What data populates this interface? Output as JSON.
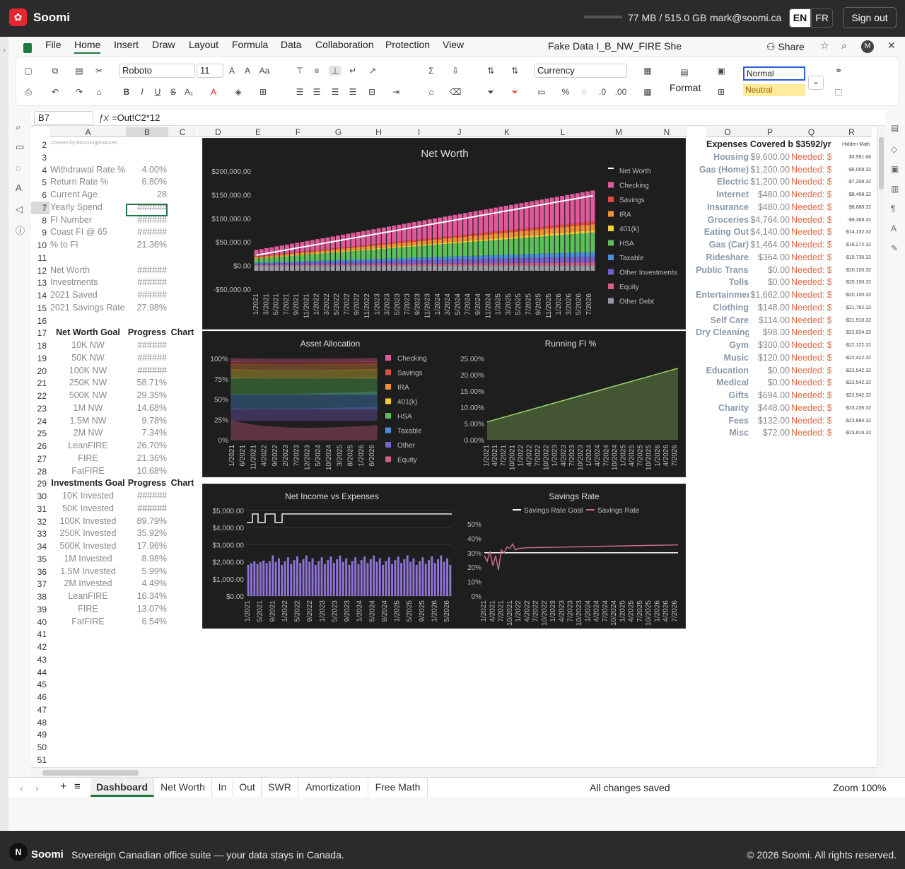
{
  "app": {
    "brand": "Soomi",
    "storage": "77 MB / 515.0 GB",
    "email": "mark@soomi.ca",
    "lang_en": "EN",
    "lang_fr": "FR",
    "signout": "Sign out"
  },
  "menu": [
    "File",
    "Home",
    "Insert",
    "Draw",
    "Layout",
    "Formula",
    "Data",
    "Collaboration",
    "Protection",
    "View"
  ],
  "doc": {
    "title": "Fake Data I_B_NW_FIRE She",
    "share": "Share"
  },
  "ribbon": {
    "font": "Roboto",
    "size": "11",
    "number_format": "Currency",
    "format_label": "Format",
    "style_normal": "Normal",
    "style_neutral": "Neutral"
  },
  "formula_bar": {
    "cell": "B7",
    "formula": "=Out!C2*12"
  },
  "columns": [
    "A",
    "B",
    "C",
    "D",
    "E",
    "F",
    "G",
    "H",
    "I",
    "J",
    "K",
    "L",
    "M",
    "N",
    "O",
    "P",
    "Q",
    "R"
  ],
  "rows_top": [
    "2",
    "3",
    "4",
    "5",
    "6",
    "7",
    "8",
    "9",
    "10",
    "11",
    "12",
    "13",
    "14",
    "15",
    "16",
    "17",
    "18",
    "19",
    "20",
    "21",
    "22",
    "23",
    "24",
    "25",
    "26",
    "27",
    "28",
    "29",
    "30",
    "31",
    "32",
    "33",
    "34",
    "35",
    "36",
    "37",
    "38",
    "39",
    "40",
    "41",
    "42",
    "43",
    "44",
    "45",
    "46",
    "47",
    "48",
    "49",
    "50",
    "51"
  ],
  "left_table": {
    "partial_row_text": "Created by BloomingFinances",
    "stats": [
      {
        "row": 4,
        "label": "Withdrawal Rate %",
        "value": "4.00%"
      },
      {
        "row": 5,
        "label": "Return Rate %",
        "value": "6.80%"
      },
      {
        "row": 6,
        "label": "Current Age",
        "value": "28"
      },
      {
        "row": 7,
        "label": "Yearly Spend",
        "value": "######"
      },
      {
        "row": 8,
        "label": "FI Number",
        "value": "######"
      },
      {
        "row": 9,
        "label": "Coast FI @ 65",
        "value": "######"
      },
      {
        "row": 10,
        "label": "% to FI",
        "value": "21.36%"
      },
      {
        "row": 12,
        "label": "Net Worth",
        "value": "######"
      },
      {
        "row": 13,
        "label": "Investments",
        "value": "######"
      },
      {
        "row": 14,
        "label": "2021 Saved",
        "value": "######"
      },
      {
        "row": 15,
        "label": "2021 Savings Rate",
        "value": "27.98%"
      }
    ],
    "nw_header": [
      "Net Worth Goal",
      "Progress",
      "Chart"
    ],
    "nw_goals": [
      [
        "10K NW",
        "######"
      ],
      [
        "50K NW",
        "######"
      ],
      [
        "100K NW",
        "######"
      ],
      [
        "250K NW",
        "58.71%"
      ],
      [
        "500K NW",
        "29.35%"
      ],
      [
        "1M NW",
        "14.68%"
      ],
      [
        "1.5M NW",
        "9.78%"
      ],
      [
        "2M NW",
        "7.34%"
      ],
      [
        "LeanFIRE",
        "26.70%"
      ],
      [
        "FIRE",
        "21.36%"
      ],
      [
        "FatFIRE",
        "10.68%"
      ]
    ],
    "inv_header": [
      "Investments Goal",
      "Progress",
      "Chart"
    ],
    "inv_goals": [
      [
        "10K Invested",
        "######"
      ],
      [
        "50K Invested",
        "######"
      ],
      [
        "100K Invested",
        "89.79%"
      ],
      [
        "250K Invested",
        "35.92%"
      ],
      [
        "500K Invested",
        "17.96%"
      ],
      [
        "1M Invested",
        "8.98%"
      ],
      [
        "1.5M Invested",
        "5.99%"
      ],
      [
        "2M Invested",
        "4.49%"
      ],
      [
        "LeanFIRE",
        "16.34%"
      ],
      [
        "FIRE",
        "13.07%"
      ],
      [
        "FatFIRE",
        "6.54%"
      ]
    ]
  },
  "expenses": {
    "title": "Expenses Covered b $3592/yr",
    "hidden_label": "Hidden Math",
    "items": [
      [
        "Housing",
        "$9,600.00",
        "Needed: $",
        "$3,591.68"
      ],
      [
        "Gas (Home)",
        "$1,200.00",
        "Needed: $",
        "-$6,008.32"
      ],
      [
        "Electric",
        "$1,200.00",
        "Needed: $",
        "-$7,208.32"
      ],
      [
        "Internet",
        "$480.00",
        "Needed: $",
        "-$8,408.32"
      ],
      [
        "Insurance",
        "$480.00",
        "Needed: $",
        "-$8,888.32"
      ],
      [
        "Groceries",
        "$4,764.00",
        "Needed: $",
        "-$9,368.32"
      ],
      [
        "Eating Out",
        "$4,140.00",
        "Needed: $",
        "-$14,132.32"
      ],
      [
        "Gas (Car)",
        "$1,464.00",
        "Needed: $",
        "-$18,272.32"
      ],
      [
        "Rideshare",
        "$364.00",
        "Needed: $",
        "-$19,736.32"
      ],
      [
        "Public Transi",
        "$0.00",
        "Needed: $",
        "-$20,100.32"
      ],
      [
        "Tolls",
        "$0.00",
        "Needed: $",
        "-$20,100.32"
      ],
      [
        "Entertainmer",
        "$1,662.00",
        "Needed: $",
        "-$20,100.32"
      ],
      [
        "Clothing",
        "$148.00",
        "Needed: $5",
        "-$21,762.32"
      ],
      [
        "Self Care",
        "$114.00",
        "Needed: $",
        "-$21,910.32"
      ],
      [
        "Dry Cleaning",
        "$98.00",
        "Needed: $",
        "-$22,024.32"
      ],
      [
        "Gym",
        "$300.00",
        "Needed: $",
        "-$22,122.32"
      ],
      [
        "Music",
        "$120.00",
        "Needed: $",
        "-$22,422.32"
      ],
      [
        "Education",
        "$0.00",
        "Needed: $",
        "-$22,542.32"
      ],
      [
        "Medical",
        "$0.00",
        "Needed: $",
        "-$22,542.32"
      ],
      [
        "Gifts",
        "$694.00",
        "Needed: $",
        "-$22,542.32"
      ],
      [
        "Charity",
        "$448.00",
        "Needed: $",
        "-$23,236.32"
      ],
      [
        "Fees",
        "$132.00",
        "Needed: $",
        "-$23,684.32"
      ],
      [
        "Misc",
        "$72.00",
        "Needed: $",
        "-$23,816.32"
      ]
    ]
  },
  "chart_data": [
    {
      "type": "bar",
      "title": "Net Worth",
      "y_ticks": [
        "$200,000.00",
        "$150,000.00",
        "$100,000.00",
        "$50,000.00",
        "$0.00",
        "-$50,000.00"
      ],
      "ylim": [
        -50000,
        200000
      ],
      "x_ticks": [
        "1/2021",
        "3/2021",
        "5/2021",
        "7/2021",
        "9/2021",
        "11/2021",
        "1/2022",
        "3/2022",
        "5/2022",
        "7/2022",
        "9/2022",
        "11/2022",
        "1/2023",
        "3/2023",
        "5/2023",
        "7/2023",
        "9/2023",
        "11/2023",
        "1/2024",
        "3/2024",
        "5/2024",
        "7/2024",
        "9/2024",
        "11/2024",
        "1/2025",
        "3/2025",
        "5/2025",
        "7/2025",
        "9/2025",
        "11/2025",
        "1/2026",
        "3/2026",
        "5/2026",
        "7/2026"
      ],
      "net_worth_start": 22000,
      "net_worth_end": 148000,
      "legend": [
        "Net Worth",
        "Checking",
        "Savings",
        "IRA",
        "401(k)",
        "HSA",
        "Taxable",
        "Other Investments",
        "Equity",
        "Other Debt"
      ],
      "colors": [
        "#ffffff",
        "#e05a9b",
        "#e34b4b",
        "#f0913a",
        "#f3cf3a",
        "#5cbf5c",
        "#4a90d9",
        "#7a5fc9",
        "#d65f8a",
        "#9a9aa6"
      ]
    },
    {
      "type": "area",
      "title": "Asset Allocation",
      "y_ticks": [
        "100%",
        "75%",
        "50%",
        "25%",
        "0%"
      ],
      "x_ticks": [
        "1/2021",
        "6/2021",
        "11/2021",
        "4/2022",
        "9/2022",
        "2/2023",
        "7/2023",
        "12/2023",
        "5/2024",
        "10/2024",
        "3/2025",
        "8/2025",
        "1/2026",
        "6/2026"
      ],
      "legend": [
        "Checking",
        "Savings",
        "IRA",
        "401(k)",
        "HSA",
        "Taxable",
        "Other",
        "Equity"
      ],
      "colors": [
        "#e05a9b",
        "#e34b4b",
        "#f0913a",
        "#f3cf3a",
        "#5cbf5c",
        "#4a90d9",
        "#7a5fc9",
        "#d65f8a"
      ]
    },
    {
      "type": "area",
      "title": "Running FI %",
      "y_ticks": [
        "25.00%",
        "20.00%",
        "15.00%",
        "10.00%",
        "5.00%",
        "0.00%"
      ],
      "x_ticks": [
        "1/2021",
        "4/2021",
        "7/2021",
        "10/2021",
        "1/2022",
        "4/2022",
        "7/2022",
        "10/2022",
        "1/2023",
        "4/2023",
        "7/2023",
        "10/2023",
        "1/2024",
        "4/2024",
        "7/2024",
        "10/2024",
        "1/2025",
        "4/2025",
        "7/2025",
        "10/2025",
        "1/2026",
        "4/2026",
        "7/2026"
      ],
      "start": 5.5,
      "end": 22.0,
      "ylim": [
        0,
        25
      ]
    },
    {
      "type": "bar",
      "title": "Net Income vs Expenses",
      "y_ticks": [
        "$5,000.00",
        "$4,000.00",
        "$3,000.00",
        "$2,000.00",
        "$1,000.00",
        "$0.00"
      ],
      "ylim": [
        0,
        5000
      ],
      "x_ticks": [
        "1/2021",
        "5/2021",
        "9/2021",
        "1/2022",
        "5/2022",
        "9/2022",
        "1/2023",
        "5/2023",
        "9/2023",
        "1/2024",
        "5/2024",
        "9/2024",
        "1/2025",
        "5/2025",
        "9/2025",
        "1/2026",
        "5/2026"
      ],
      "expense_level": 2100,
      "income_level": 4800
    },
    {
      "type": "line",
      "title": "Savings Rate",
      "legend": [
        "Savings Rate Goal",
        "Savings Rate"
      ],
      "y_ticks": [
        "50%",
        "40%",
        "30%",
        "20%",
        "10%",
        "0%"
      ],
      "ylim": [
        0,
        50
      ],
      "x_ticks": [
        "1/2021",
        "4/2021",
        "7/2021",
        "10/2021",
        "1/2022",
        "4/2022",
        "7/2022",
        "10/2022",
        "1/2023",
        "4/2023",
        "7/2023",
        "10/2023",
        "1/2024",
        "4/2024",
        "7/2024",
        "10/2024",
        "1/2025",
        "4/2025",
        "7/2025",
        "10/2025",
        "1/2026",
        "4/2026",
        "7/2026"
      ],
      "goal": 30,
      "rate_end": 36
    }
  ],
  "tabs": [
    "Dashboard",
    "Net Worth",
    "In",
    "Out",
    "SWR",
    "Amortization",
    "Free Math"
  ],
  "status": {
    "saved": "All changes saved",
    "zoom": "Zoom 100%"
  },
  "footer": {
    "brand": "Soomi",
    "tagline": "Sovereign Canadian office suite — your data stays in Canada.",
    "copyright": "© 2026 Soomi. All rights reserved."
  }
}
